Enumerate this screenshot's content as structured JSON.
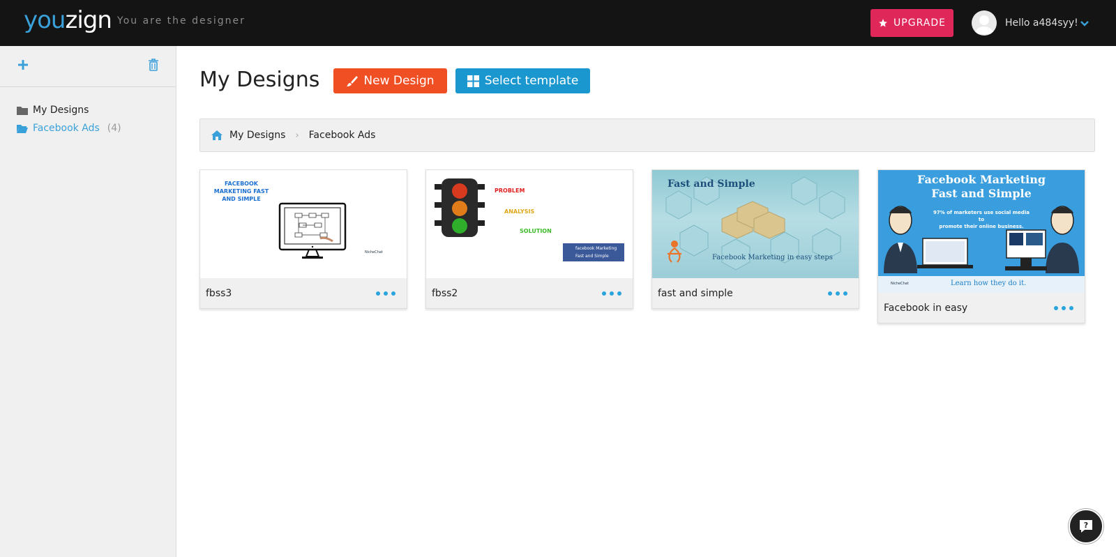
{
  "header": {
    "logo_you": "you",
    "logo_zign": "zign",
    "tagline": "You are the designer",
    "upgrade_label": "UPGRADE",
    "greeting": "Hello a484syy!"
  },
  "sidebar": {
    "folders": [
      {
        "label": "My Designs",
        "count": ""
      },
      {
        "label": "Facebook Ads",
        "count": "(4)"
      }
    ]
  },
  "main": {
    "title": "My Designs",
    "new_design_label": "New Design",
    "select_template_label": "Select template",
    "breadcrumb": [
      "My Designs",
      "Facebook Ads"
    ]
  },
  "designs": [
    {
      "name": "fbss3",
      "thumb_text": [
        "FACEBOOK",
        "MARKETING FAST",
        "AND SIMPLE"
      ],
      "thumb_brand": "NicheChat"
    },
    {
      "name": "fbss2",
      "thumb_text": [
        "PROBLEM",
        "ANALYSIS",
        "SOLUTION"
      ],
      "thumb_badge": [
        "facebook Marketing",
        "Fast and Simple"
      ]
    },
    {
      "name": "fast and simple",
      "thumb_text": [
        "Fast and Simple",
        "Facebook Marketing in easy steps"
      ]
    },
    {
      "name": "Facebook in easy",
      "thumb_text": [
        "Facebook Marketing",
        "Fast and Simple",
        "97% of marketers use social media to",
        "promote their online business.",
        "Learn how they do it."
      ],
      "thumb_brand": "NicheChat"
    }
  ],
  "colors": {
    "topbar": "#141414",
    "accent_blue": "#1a97cf",
    "upgrade_pink": "#e0275a",
    "new_design_orange": "#f04e23"
  }
}
